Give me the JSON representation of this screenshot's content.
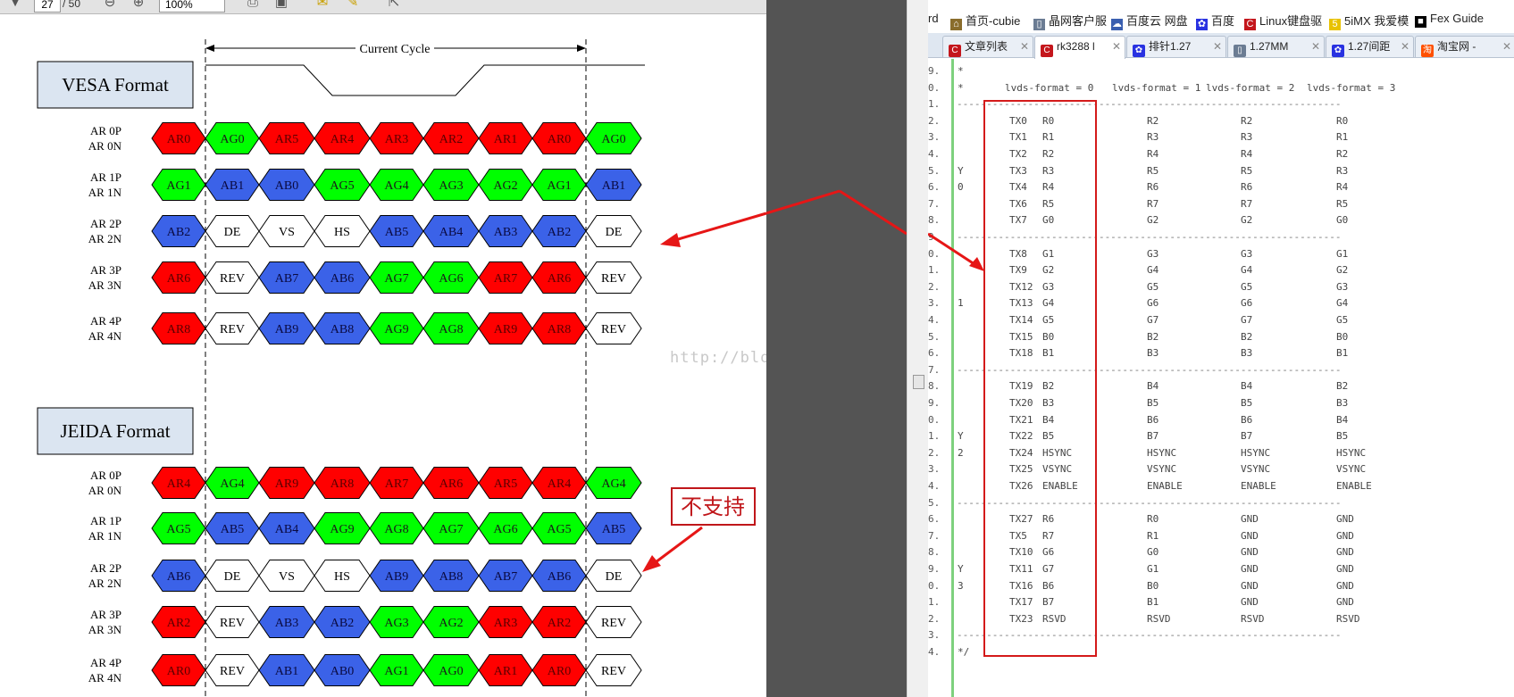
{
  "pdf_toolbar": {
    "page": "27",
    "page_total": "/ 50",
    "zoom": "100%",
    "tool1": "工具",
    "tool2": "签名",
    "tool3": "注释"
  },
  "diagram": {
    "cycle_label": "Current Cycle",
    "watermark": "http://blog.csdn.net/",
    "note": "不支持",
    "vesa": {
      "title": "VESA Format",
      "rows": [
        {
          "p": "AR 0P",
          "n": "AR 0N",
          "cells": [
            [
              "AR0",
              "r"
            ],
            [
              "AG0",
              "g"
            ],
            [
              "AR5",
              "r"
            ],
            [
              "AR4",
              "r"
            ],
            [
              "AR3",
              "r"
            ],
            [
              "AR2",
              "r"
            ],
            [
              "AR1",
              "r"
            ],
            [
              "AR0",
              "r"
            ],
            [
              "AG0",
              "g"
            ]
          ]
        },
        {
          "p": "AR 1P",
          "n": "AR 1N",
          "cells": [
            [
              "AG1",
              "g"
            ],
            [
              "AB1",
              "b"
            ],
            [
              "AB0",
              "b"
            ],
            [
              "AG5",
              "g"
            ],
            [
              "AG4",
              "g"
            ],
            [
              "AG3",
              "g"
            ],
            [
              "AG2",
              "g"
            ],
            [
              "AG1",
              "g"
            ],
            [
              "AB1",
              "b"
            ]
          ]
        },
        {
          "p": "AR 2P",
          "n": "AR 2N",
          "cells": [
            [
              "AB2",
              "b"
            ],
            [
              "DE",
              "w"
            ],
            [
              "VS",
              "w"
            ],
            [
              "HS",
              "w"
            ],
            [
              "AB5",
              "b"
            ],
            [
              "AB4",
              "b"
            ],
            [
              "AB3",
              "b"
            ],
            [
              "AB2",
              "b"
            ],
            [
              "DE",
              "w"
            ]
          ]
        },
        {
          "p": "AR 3P",
          "n": "AR 3N",
          "cells": [
            [
              "AR6",
              "r"
            ],
            [
              "REV",
              "w"
            ],
            [
              "AB7",
              "b"
            ],
            [
              "AB6",
              "b"
            ],
            [
              "AG7",
              "g"
            ],
            [
              "AG6",
              "g"
            ],
            [
              "AR7",
              "r"
            ],
            [
              "AR6",
              "r"
            ],
            [
              "REV",
              "w"
            ]
          ]
        },
        {
          "p": "AR 4P",
          "n": "AR 4N",
          "cells": [
            [
              "AR8",
              "r"
            ],
            [
              "REV",
              "w"
            ],
            [
              "AB9",
              "b"
            ],
            [
              "AB8",
              "b"
            ],
            [
              "AG9",
              "g"
            ],
            [
              "AG8",
              "g"
            ],
            [
              "AR9",
              "r"
            ],
            [
              "AR8",
              "r"
            ],
            [
              "REV",
              "w"
            ]
          ]
        }
      ]
    },
    "jeida": {
      "title": "JEIDA Format",
      "rows": [
        {
          "p": "AR 0P",
          "n": "AR 0N",
          "cells": [
            [
              "AR4",
              "r"
            ],
            [
              "AG4",
              "g"
            ],
            [
              "AR9",
              "r"
            ],
            [
              "AR8",
              "r"
            ],
            [
              "AR7",
              "r"
            ],
            [
              "AR6",
              "r"
            ],
            [
              "AR5",
              "r"
            ],
            [
              "AR4",
              "r"
            ],
            [
              "AG4",
              "g"
            ]
          ]
        },
        {
          "p": "AR 1P",
          "n": "AR 1N",
          "cells": [
            [
              "AG5",
              "g"
            ],
            [
              "AB5",
              "b"
            ],
            [
              "AB4",
              "b"
            ],
            [
              "AG9",
              "g"
            ],
            [
              "AG8",
              "g"
            ],
            [
              "AG7",
              "g"
            ],
            [
              "AG6",
              "g"
            ],
            [
              "AG5",
              "g"
            ],
            [
              "AB5",
              "b"
            ]
          ]
        },
        {
          "p": "AR 2P",
          "n": "AR 2N",
          "cells": [
            [
              "AB6",
              "b"
            ],
            [
              "DE",
              "w"
            ],
            [
              "VS",
              "w"
            ],
            [
              "HS",
              "w"
            ],
            [
              "AB9",
              "b"
            ],
            [
              "AB8",
              "b"
            ],
            [
              "AB7",
              "b"
            ],
            [
              "AB6",
              "b"
            ],
            [
              "DE",
              "w"
            ]
          ]
        },
        {
          "p": "AR 3P",
          "n": "AR 3N",
          "cells": [
            [
              "AR2",
              "r"
            ],
            [
              "REV",
              "w"
            ],
            [
              "AB3",
              "b"
            ],
            [
              "AB2",
              "b"
            ],
            [
              "AG3",
              "g"
            ],
            [
              "AG2",
              "g"
            ],
            [
              "AR3",
              "r"
            ],
            [
              "AR2",
              "r"
            ],
            [
              "REV",
              "w"
            ]
          ]
        },
        {
          "p": "AR 4P",
          "n": "AR 4N",
          "cells": [
            [
              "AR0",
              "r"
            ],
            [
              "REV",
              "w"
            ],
            [
              "AB1",
              "b"
            ],
            [
              "AB0",
              "b"
            ],
            [
              "AG1",
              "g"
            ],
            [
              "AG0",
              "g"
            ],
            [
              "AR1",
              "r"
            ],
            [
              "AR0",
              "r"
            ],
            [
              "REV",
              "w"
            ]
          ]
        }
      ]
    },
    "colors": {
      "r": "#ff0000",
      "g": "#00ff00",
      "b": "#3b62e8",
      "w": "#ffffff"
    }
  },
  "browser": {
    "bookmarks": [
      {
        "label": "rd",
        "icon": "none",
        "color": "#000000"
      },
      {
        "label": "首页-cubie",
        "icon": "home-icon",
        "color": "#8a6d2c"
      },
      {
        "label": "晶网客户服",
        "icon": "page-icon",
        "color": "#6b7c93"
      },
      {
        "label": "百度云 网盘",
        "icon": "cloud-icon",
        "color": "#3a5fb0"
      },
      {
        "label": "百度",
        "icon": "paw-icon",
        "color": "#2932e1"
      },
      {
        "label": "Linux键盘驱",
        "icon": "csdn-icon",
        "color": "#c4161c"
      },
      {
        "label": "5iMX 我爱模",
        "icon": "5imx-icon",
        "color": "#e8c200"
      },
      {
        "label": "Fex Guide",
        "icon": "fex-icon",
        "color": "#000000"
      }
    ],
    "tabs": [
      {
        "label": "文章列表",
        "icon": "csdn-icon",
        "color": "#c4161c"
      },
      {
        "label": "rk3288 l",
        "icon": "csdn-icon",
        "color": "#c4161c",
        "active": true
      },
      {
        "label": "排针1.27",
        "icon": "paw-icon",
        "color": "#2932e1"
      },
      {
        "label": "1.27MM",
        "icon": "page-icon",
        "color": "#6b7c93"
      },
      {
        "label": "1.27间距",
        "icon": "paw-icon",
        "color": "#2932e1"
      },
      {
        "label": "淘宝网 -",
        "icon": "taobao-icon",
        "color": "#ff5000"
      }
    ]
  },
  "code": {
    "header": [
      "lvds-format = 0",
      "lvds-format = 1",
      "lvds-format = 2",
      "lvds-format = 3"
    ],
    "lines": [
      {
        "ln": "9.",
        "kind": "text",
        "marker": "*"
      },
      {
        "ln": "0.",
        "kind": "header",
        "marker": "*"
      },
      {
        "ln": "1.",
        "kind": "sep"
      },
      {
        "ln": "2.",
        "kind": "row",
        "tx": "TX0",
        "v": [
          "R0",
          "R2",
          "R2",
          "R0"
        ]
      },
      {
        "ln": "3.",
        "kind": "row",
        "tx": "TX1",
        "v": [
          "R1",
          "R3",
          "R3",
          "R1"
        ]
      },
      {
        "ln": "4.",
        "kind": "row",
        "tx": "TX2",
        "v": [
          "R2",
          "R4",
          "R4",
          "R2"
        ]
      },
      {
        "ln": "5.",
        "kind": "row",
        "side": "Y",
        "tx": "TX3",
        "v": [
          "R3",
          "R5",
          "R5",
          "R3"
        ]
      },
      {
        "ln": "6.",
        "kind": "row",
        "side": "0",
        "tx": "TX4",
        "v": [
          "R4",
          "R6",
          "R6",
          "R4"
        ]
      },
      {
        "ln": "7.",
        "kind": "row",
        "tx": "TX6",
        "v": [
          "R5",
          "R7",
          "R7",
          "R5"
        ]
      },
      {
        "ln": "8.",
        "kind": "row",
        "tx": "TX7",
        "v": [
          "G0",
          "G2",
          "G2",
          "G0"
        ]
      },
      {
        "ln": "9.",
        "kind": "sep"
      },
      {
        "ln": "0.",
        "kind": "row",
        "tx": "TX8",
        "v": [
          "G1",
          "G3",
          "G3",
          "G1"
        ]
      },
      {
        "ln": "1.",
        "kind": "row",
        "tx": "TX9",
        "v": [
          "G2",
          "G4",
          "G4",
          "G2"
        ]
      },
      {
        "ln": "2.",
        "kind": "row",
        "tx": "TX12",
        "v": [
          "G3",
          "G5",
          "G5",
          "G3"
        ]
      },
      {
        "ln": "3.",
        "kind": "row",
        "side": "1",
        "tx": "TX13",
        "v": [
          "G4",
          "G6",
          "G6",
          "G4"
        ]
      },
      {
        "ln": "4.",
        "kind": "row",
        "tx": "TX14",
        "v": [
          "G5",
          "G7",
          "G7",
          "G5"
        ]
      },
      {
        "ln": "5.",
        "kind": "row",
        "tx": "TX15",
        "v": [
          "B0",
          "B2",
          "B2",
          "B0"
        ]
      },
      {
        "ln": "6.",
        "kind": "row",
        "tx": "TX18",
        "v": [
          "B1",
          "B3",
          "B3",
          "B1"
        ]
      },
      {
        "ln": "7.",
        "kind": "sep"
      },
      {
        "ln": "8.",
        "kind": "row",
        "tx": "TX19",
        "v": [
          "B2",
          "B4",
          "B4",
          "B2"
        ]
      },
      {
        "ln": "9.",
        "kind": "row",
        "tx": "TX20",
        "v": [
          "B3",
          "B5",
          "B5",
          "B3"
        ]
      },
      {
        "ln": "0.",
        "kind": "row",
        "tx": "TX21",
        "v": [
          "B4",
          "B6",
          "B6",
          "B4"
        ]
      },
      {
        "ln": "1.",
        "kind": "row",
        "side": "Y",
        "tx": "TX22",
        "v": [
          "B5",
          "B7",
          "B7",
          "B5"
        ]
      },
      {
        "ln": "2.",
        "kind": "row",
        "side": "2",
        "tx": "TX24",
        "v": [
          "HSYNC",
          "HSYNC",
          "HSYNC",
          "HSYNC"
        ]
      },
      {
        "ln": "3.",
        "kind": "row",
        "tx": "TX25",
        "v": [
          "VSYNC",
          "VSYNC",
          "VSYNC",
          "VSYNC"
        ]
      },
      {
        "ln": "4.",
        "kind": "row",
        "tx": "TX26",
        "v": [
          "ENABLE",
          "ENABLE",
          "ENABLE",
          "ENABLE"
        ]
      },
      {
        "ln": "5.",
        "kind": "sep"
      },
      {
        "ln": "6.",
        "kind": "row",
        "tx": "TX27",
        "v": [
          "R6",
          "R0",
          "GND",
          "GND"
        ]
      },
      {
        "ln": "7.",
        "kind": "row",
        "tx": "TX5",
        "v": [
          "R7",
          "R1",
          "GND",
          "GND"
        ]
      },
      {
        "ln": "8.",
        "kind": "row",
        "tx": "TX10",
        "v": [
          "G6",
          "G0",
          "GND",
          "GND"
        ]
      },
      {
        "ln": "9.",
        "kind": "row",
        "side": "Y",
        "tx": "TX11",
        "v": [
          "G7",
          "G1",
          "GND",
          "GND"
        ]
      },
      {
        "ln": "0.",
        "kind": "row",
        "side": "3",
        "tx": "TX16",
        "v": [
          "B6",
          "B0",
          "GND",
          "GND"
        ]
      },
      {
        "ln": "1.",
        "kind": "row",
        "tx": "TX17",
        "v": [
          "B7",
          "B1",
          "GND",
          "GND"
        ]
      },
      {
        "ln": "2.",
        "kind": "row",
        "tx": "TX23",
        "v": [
          "RSVD",
          "RSVD",
          "RSVD",
          "RSVD"
        ]
      },
      {
        "ln": "3.",
        "kind": "sep"
      },
      {
        "ln": "4.",
        "kind": "text",
        "marker": "*/"
      }
    ]
  }
}
